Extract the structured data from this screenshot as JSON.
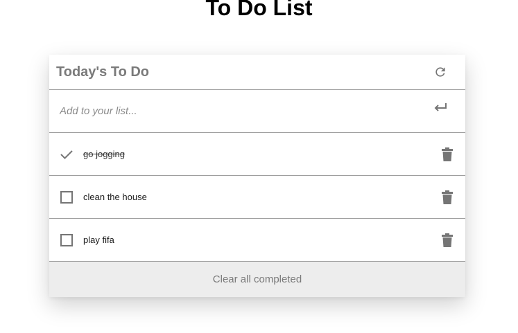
{
  "page": {
    "title": "To Do List"
  },
  "card": {
    "title": "Today's To Do",
    "refresh_icon": "refresh-icon"
  },
  "input": {
    "placeholder": "Add to your list...",
    "value": "",
    "submit_icon": "enter-arrow-icon"
  },
  "todos": [
    {
      "text": "go jogging",
      "completed": true
    },
    {
      "text": "clean the house",
      "completed": false
    },
    {
      "text": "play fifa",
      "completed": false
    }
  ],
  "footer": {
    "clear_label": "Clear all completed"
  },
  "colors": {
    "icon": "#757575",
    "footer_bg": "#ededed",
    "divider": "#9e9e9e"
  }
}
